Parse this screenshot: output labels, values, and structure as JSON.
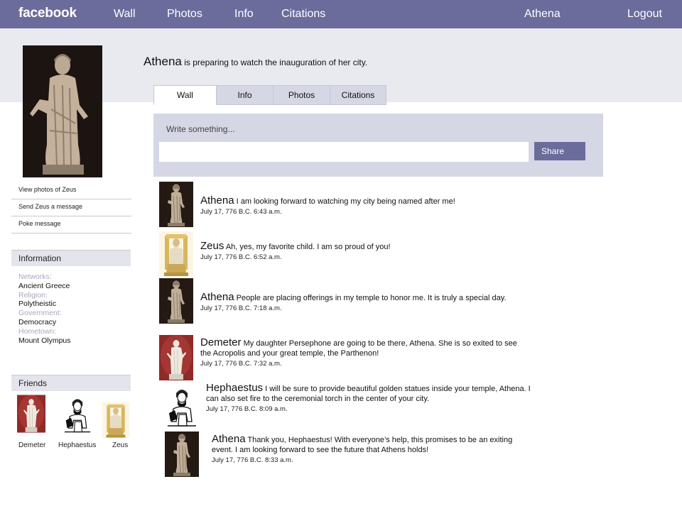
{
  "topbar": {
    "brand": "facebook",
    "nav": [
      "Wall",
      "Photos",
      "Info",
      "Citations"
    ],
    "user": "Athena",
    "logout": "Logout"
  },
  "profile": {
    "name": "Athena",
    "status": "is preparing to watch the inauguration of her city."
  },
  "tabs": [
    "Wall",
    "Info",
    "Photos",
    "Citations"
  ],
  "publisher": {
    "prompt": "Write something...",
    "input_value": "",
    "share_label": "Share"
  },
  "sidebar": {
    "links": [
      "View photos of Zeus",
      "Send Zeus a message",
      "Poke message"
    ],
    "information": {
      "header": "Information",
      "fields": [
        {
          "label": "Networks:",
          "value": "Ancient Greece"
        },
        {
          "label": "Religion:",
          "value": "Polytheistic"
        },
        {
          "label": "Government:",
          "value": "Democracy"
        },
        {
          "label": "Hometown:",
          "value": "Mount Olympus"
        }
      ]
    },
    "friends": {
      "header": "Friends",
      "list": [
        "Demeter",
        "Hephaestus",
        "Zeus"
      ]
    }
  },
  "posts": [
    {
      "author": "Athena",
      "text": "I am looking forward to watching my city being named after me!",
      "time": "July 17, 776 B.C. 6:43 a.m."
    },
    {
      "author": "Zeus",
      "text": "Ah, yes, my favorite child. I am so proud of you!",
      "time": "July 17, 776 B.C. 6:52 a.m."
    },
    {
      "author": "Athena",
      "text": "People are placing offerings in my temple to honor me.  It is truly a special day.",
      "time": "July 17, 776 B.C. 7:18 a.m."
    },
    {
      "author": "Demeter",
      "text": "My daughter Persephone are going to be there, Athena. She is so exited to see the Acropolis and  your great temple, the Parthenon!",
      "time": "July 17, 776 B.C. 7:32 a.m."
    },
    {
      "author": "Hephaestus",
      "text": "I will be sure to provide beautiful  golden statues inside your  temple, Athena.  I can also set fire to the ceremonial torch in the center of your city.",
      "time": "July 17, 776 B.C. 8:09 a.m."
    },
    {
      "author": "Athena",
      "text": "Thank you, Hephaestus!  With everyone’s help, this promises to be an exiting event.  I am looking forward to see the future that Athens holds!",
      "time": "July 17, 776 B.C. 8:33 a.m."
    }
  ],
  "colors": {
    "topbar": "#6b6c9c",
    "band": "#e9eaf0",
    "panel": "#d6d7e4",
    "label_muted": "#a7a8bf"
  }
}
